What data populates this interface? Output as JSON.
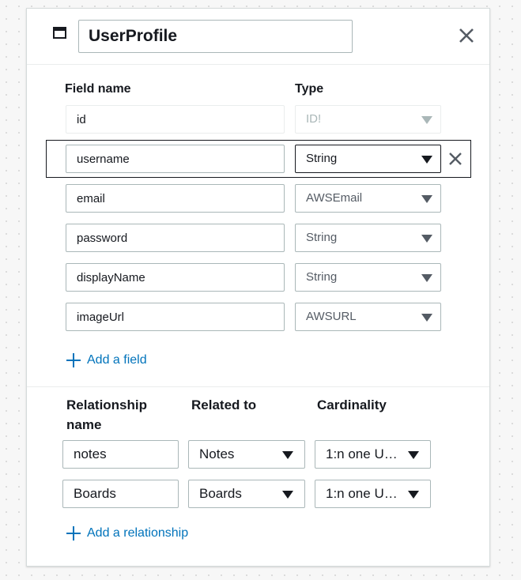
{
  "model": {
    "name": "UserProfile"
  },
  "fields_header": {
    "field_name": "Field name",
    "type": "Type"
  },
  "fields": [
    {
      "name": "id",
      "type": "ID!"
    },
    {
      "name": "username",
      "type": "String"
    },
    {
      "name": "email",
      "type": "AWSEmail"
    },
    {
      "name": "password",
      "type": "String"
    },
    {
      "name": "displayName",
      "type": "String"
    },
    {
      "name": "imageUrl",
      "type": "AWSURL"
    }
  ],
  "add_field_label": "Add a field",
  "relationships_header": {
    "name_line1": "Relationship",
    "name_line2": "name",
    "related_to": "Related to",
    "cardinality": "Cardinality"
  },
  "relationships": [
    {
      "name": "notes",
      "related_to": "Notes",
      "cardinality": "1:n one U…"
    },
    {
      "name": "Boards",
      "related_to": "Boards",
      "cardinality": "1:n one U…"
    }
  ],
  "add_relationship_label": "Add a relationship",
  "icons": {
    "model": "table-icon",
    "close": "close-icon",
    "row_delete": "close-icon",
    "add": "plus-icon",
    "dropdown": "caret-down-icon"
  },
  "colors": {
    "link": "#0073bb",
    "text": "#16191f",
    "border": "#aab7b8",
    "selected_border": "#16191f"
  }
}
